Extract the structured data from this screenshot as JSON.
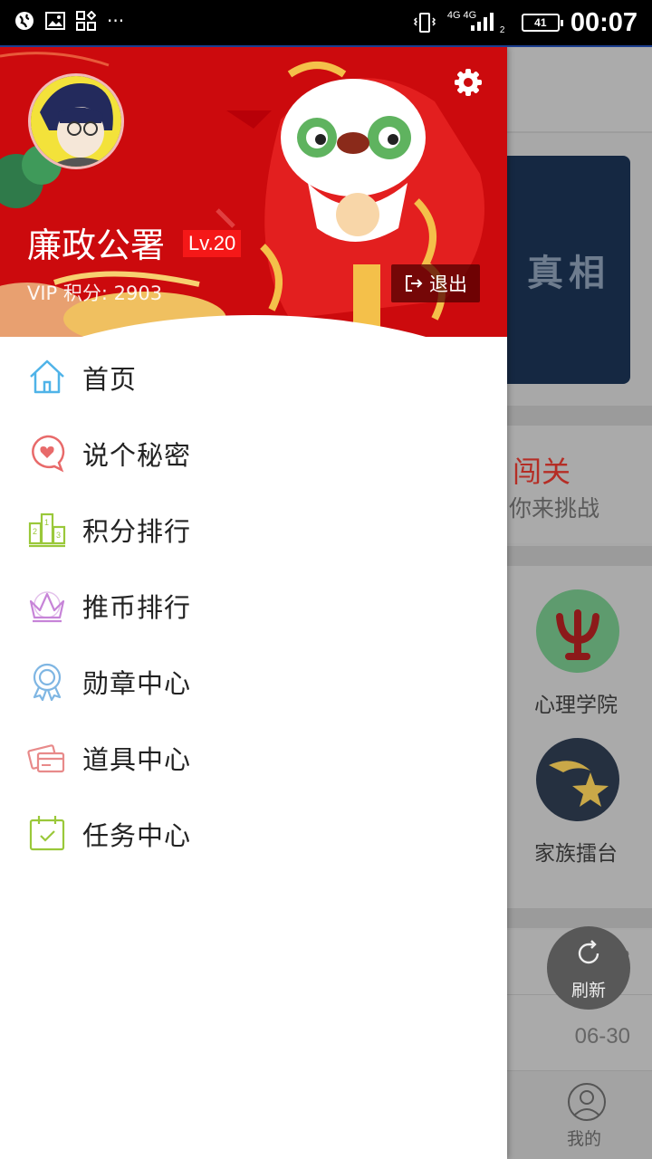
{
  "status_bar": {
    "network": "4G 4G",
    "sim_slot": "2",
    "battery": "41",
    "time": "00:07"
  },
  "drawer": {
    "username": "廉政公署",
    "level": "Lv.20",
    "vip_points": "VIP  积分: 2903",
    "logout_label": "退出",
    "menu": [
      {
        "label": "首页",
        "icon": "home-icon",
        "color": "#4fb3e8"
      },
      {
        "label": "说个秘密",
        "icon": "heart-bubble-icon",
        "color": "#e86a6a"
      },
      {
        "label": "积分排行",
        "icon": "podium-icon",
        "color": "#9ac83a"
      },
      {
        "label": "推币排行",
        "icon": "crown-icon",
        "color": "#c784d8"
      },
      {
        "label": "勋章中心",
        "icon": "medal-icon",
        "color": "#7fb6e3"
      },
      {
        "label": "道具中心",
        "icon": "cards-icon",
        "color": "#e88a8a"
      },
      {
        "label": "任务中心",
        "icon": "calendar-check-icon",
        "color": "#9ac83a"
      }
    ]
  },
  "background_app": {
    "banner_text": "真相",
    "card_title": "闯关",
    "card_subtitle": "你来挑战",
    "apps": [
      {
        "label": "心理学院",
        "icon": "psi-icon"
      },
      {
        "label": "家族擂台",
        "icon": "star-moon-icon"
      }
    ],
    "dates": [
      "07-03",
      "06-30"
    ],
    "refresh_label": "刷新",
    "tab_me_label": "我的"
  },
  "colors": {
    "header_red": "#cc0a0d",
    "level_badge": "#f51818"
  }
}
